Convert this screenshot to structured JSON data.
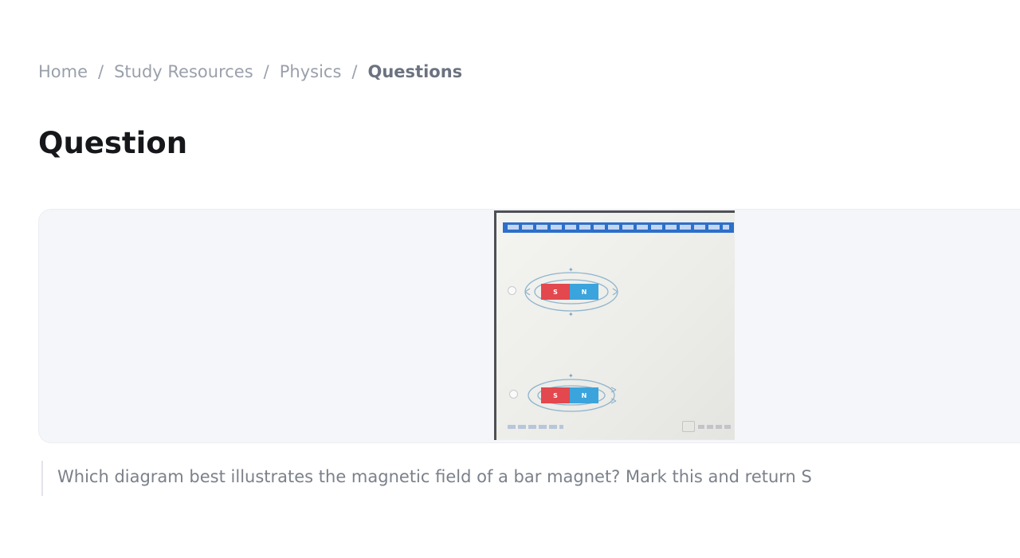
{
  "breadcrumb": {
    "items": [
      "Home",
      "Study Resources",
      "Physics"
    ],
    "separator": "/",
    "current": "Questions"
  },
  "page": {
    "title": "Question"
  },
  "question": {
    "text": "Which diagram best illustrates the magnetic field of a bar magnet? Mark this and return S"
  },
  "image": {
    "options": [
      {
        "pole_left": "S",
        "pole_right": "N"
      },
      {
        "pole_left": "S",
        "pole_right": "N"
      }
    ]
  },
  "colors": {
    "south_pole": "#e2484e",
    "north_pole": "#3ba4dc",
    "banner": "#2d6fc9"
  }
}
